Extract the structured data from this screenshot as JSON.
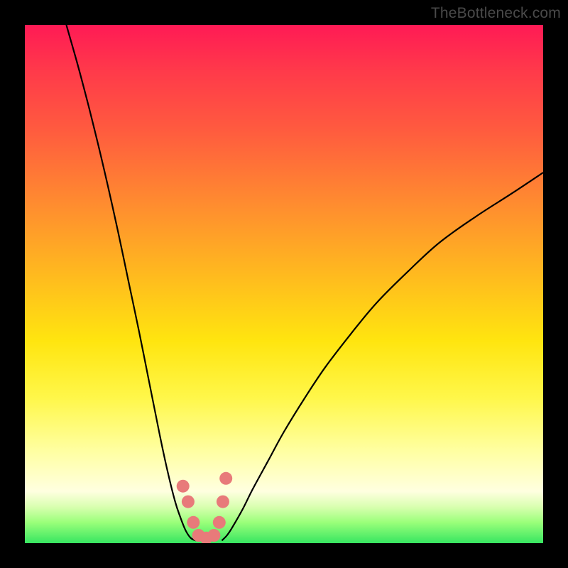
{
  "watermark": "TheBottleneck.com",
  "chart_data": {
    "type": "line",
    "title": "",
    "xlabel": "",
    "ylabel": "",
    "xlim": [
      0,
      100
    ],
    "ylim": [
      0,
      100
    ],
    "grid": false,
    "series": [
      {
        "name": "left-curve",
        "x": [
          8,
          10,
          12,
          14,
          16,
          18,
          20,
          22,
          24,
          26,
          27.5,
          29,
          30,
          31,
          32,
          33
        ],
        "y": [
          100,
          93,
          85.5,
          77.5,
          69,
          60,
          50.5,
          41,
          31,
          21,
          14,
          8,
          5,
          2.5,
          1,
          0.5
        ]
      },
      {
        "name": "right-curve",
        "x": [
          38,
          39,
          40,
          42,
          44,
          47,
          50,
          54,
          58,
          63,
          68,
          74,
          80,
          87,
          94,
          100
        ],
        "y": [
          0.5,
          1.5,
          3,
          6.5,
          10.5,
          16,
          21.5,
          28,
          34,
          40.5,
          46.5,
          52.5,
          58,
          63,
          67.5,
          71.5
        ]
      },
      {
        "name": "valley-markers",
        "x": [
          30.5,
          31.5,
          32.5,
          33.5,
          35.0,
          36.5,
          37.5,
          38.2,
          38.8
        ],
        "y": [
          11.0,
          8.0,
          4.0,
          1.5,
          1.0,
          1.5,
          4.0,
          8.0,
          12.5
        ]
      }
    ],
    "annotations": [],
    "background_gradient": {
      "stops": [
        {
          "pos": 0.0,
          "color": "#ff1a55"
        },
        {
          "pos": 0.2,
          "color": "#ff5a3f"
        },
        {
          "pos": 0.48,
          "color": "#ffb91f"
        },
        {
          "pos": 0.72,
          "color": "#fff74a"
        },
        {
          "pos": 0.9,
          "color": "#ffffe0"
        },
        {
          "pos": 1.0,
          "color": "#37e661"
        }
      ]
    }
  }
}
